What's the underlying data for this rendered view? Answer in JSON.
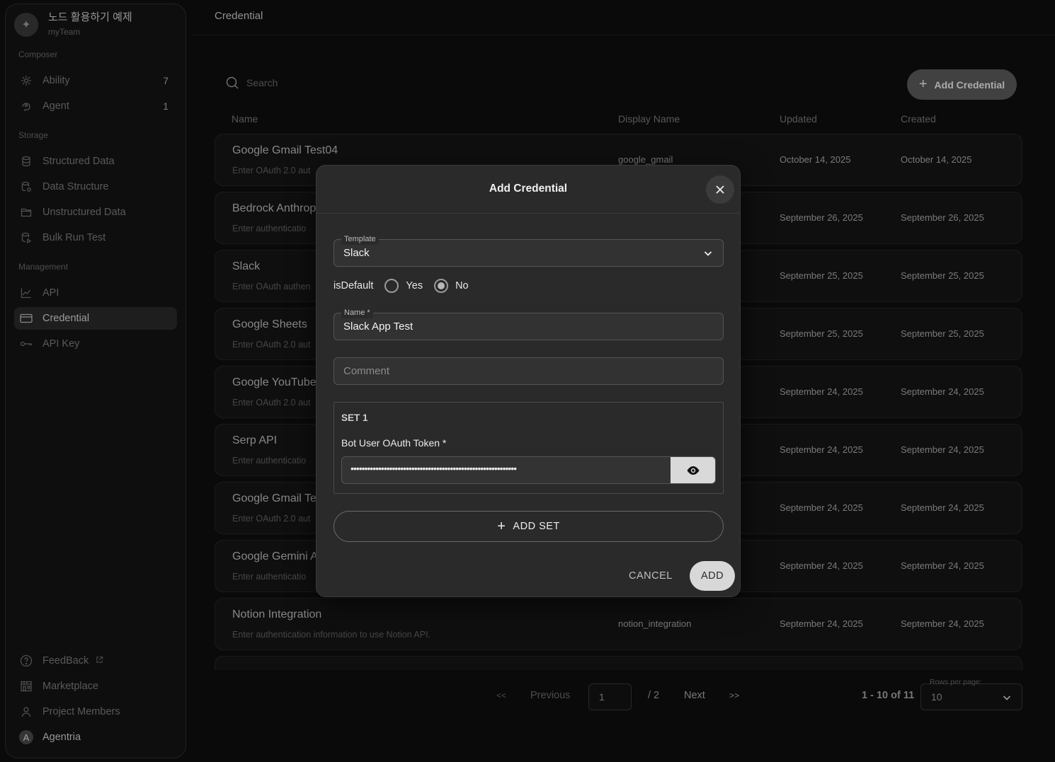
{
  "sidebar": {
    "team_name": "노드 활용하기 예제",
    "team_sub": "myTeam",
    "sections": {
      "composer": "Composer",
      "storage": "Storage",
      "management": "Management"
    },
    "items": {
      "ability": {
        "label": "Ability",
        "count": "7"
      },
      "agent": {
        "label": "Agent",
        "count": "1"
      },
      "structured_data": {
        "label": "Structured Data"
      },
      "data_structure": {
        "label": "Data Structure"
      },
      "unstructured_data": {
        "label": "Unstructured Data"
      },
      "bulk_run_test": {
        "label": "Bulk Run Test"
      },
      "api": {
        "label": "API"
      },
      "credential": {
        "label": "Credential"
      },
      "api_key": {
        "label": "API Key"
      },
      "feedback": {
        "label": "FeedBack"
      },
      "marketplace": {
        "label": "Marketplace"
      },
      "project_members": {
        "label": "Project Members"
      },
      "agentria": {
        "label": "Agentria",
        "avatar": "A"
      }
    }
  },
  "header": {
    "title": "Credential"
  },
  "search": {
    "placeholder": "Search"
  },
  "add_credential_label": "Add Credential",
  "table": {
    "columns": [
      "Name",
      "Display Name",
      "Updated",
      "Created"
    ],
    "rows": [
      {
        "name": "Google Gmail Test04",
        "desc": "Enter OAuth 2.0 aut",
        "display": "google_gmail",
        "updated": "October 14, 2025",
        "created": "October 14, 2025"
      },
      {
        "name": "Bedrock Anthrop",
        "desc": "Enter authenticatio",
        "display": "",
        "updated": "September 26, 2025",
        "created": "September 26, 2025"
      },
      {
        "name": "Slack",
        "desc": "Enter OAuth authen",
        "display": "",
        "updated": "September 25, 2025",
        "created": "September 25, 2025"
      },
      {
        "name": "Google Sheets",
        "desc": "Enter OAuth 2.0 aut",
        "display": "",
        "updated": "September 25, 2025",
        "created": "September 25, 2025"
      },
      {
        "name": "Google YouTube",
        "desc": "Enter OAuth 2.0 aut",
        "display": "",
        "updated": "September 24, 2025",
        "created": "September 24, 2025"
      },
      {
        "name": "Serp API",
        "desc": "Enter authenticatio",
        "display": "",
        "updated": "September 24, 2025",
        "created": "September 24, 2025"
      },
      {
        "name": "Google Gmail Te",
        "desc": "Enter OAuth 2.0 aut",
        "display": "",
        "updated": "September 24, 2025",
        "created": "September 24, 2025"
      },
      {
        "name": "Google Gemini A",
        "desc": "Enter authenticatio",
        "display": "",
        "updated": "September 24, 2025",
        "created": "September 24, 2025"
      },
      {
        "name": "Notion Integration",
        "desc": "Enter authentication information to use Notion API.",
        "display": "notion_integration",
        "updated": "September 24, 2025",
        "created": "September 24, 2025"
      }
    ]
  },
  "pagination": {
    "first": "<<",
    "previous": "Previous",
    "page": "1",
    "total": "/ 2",
    "next": "Next",
    "last": ">>",
    "range": "1 - 10 of 11",
    "rows_label": "Rows per page:",
    "rows_value": "10"
  },
  "modal": {
    "title": "Add Credential",
    "template_label": "Template",
    "template_value": "Slack",
    "is_default_label": "isDefault",
    "yes_label": "Yes",
    "no_label": "No",
    "is_default_value": "No",
    "name_label": "Name *",
    "name_value": "Slack App Test",
    "comment_placeholder": "Comment",
    "set_title": "SET 1",
    "token_label": "Bot User OAuth Token *",
    "token_value": "••••••••••••••••••••••••••••••••••••••••••••••••••••••••••••",
    "add_set_label": "ADD SET",
    "cancel_label": "CANCEL",
    "add_label": "ADD"
  }
}
